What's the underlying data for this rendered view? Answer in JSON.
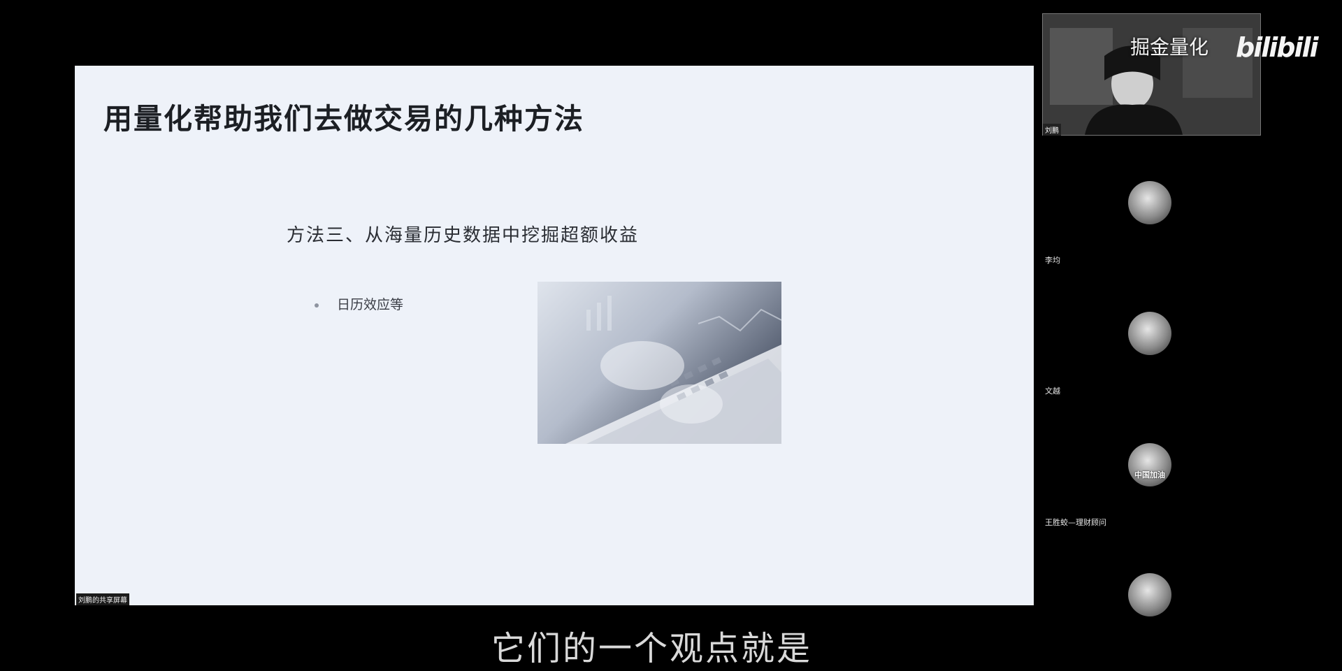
{
  "slide": {
    "title": "用量化帮助我们去做交易的几种方法",
    "subtitle": "方法三、从海量历史数据中挖掘超额收益",
    "bullets": [
      "日历效应等"
    ],
    "share_label": "刘鹏的共享屏幕"
  },
  "webcam": {
    "overlay_text": "掘金量化",
    "logo_text": "bilibili",
    "name": "刘鹏"
  },
  "participants": [
    {
      "name": "李均",
      "avatar_text": ""
    },
    {
      "name": "文越",
      "avatar_text": ""
    },
    {
      "name": "王胜蛟—理财顾问",
      "avatar_text": "中国加油"
    },
    {
      "name": "",
      "avatar_text": ""
    }
  ],
  "caption": "它们的一个观点就是",
  "colors": {
    "background": "#000000",
    "slide_background": "#eef2f9",
    "title_text": "#1c1f24"
  }
}
